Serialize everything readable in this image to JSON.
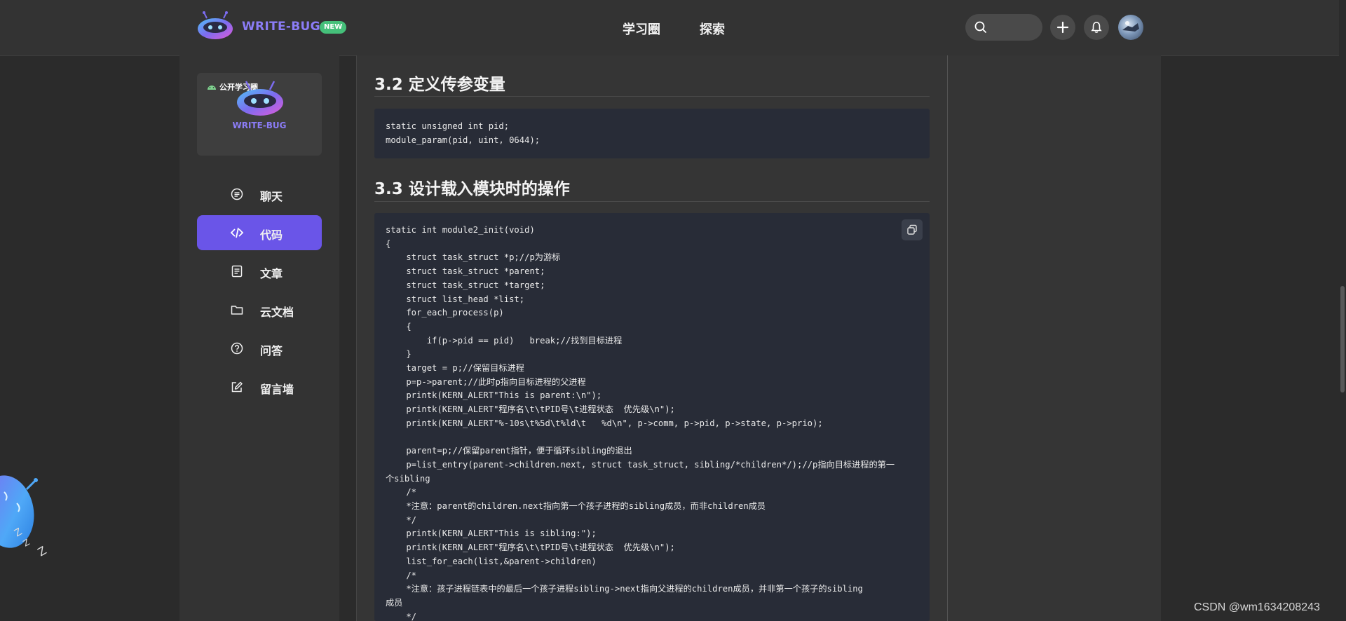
{
  "header": {
    "brand": "WRITE-BUG",
    "badge": "NEW",
    "nav": [
      "学习圈",
      "探索"
    ]
  },
  "group_card": {
    "tag": "公开学习圈",
    "brand": "WRITE-BUG"
  },
  "sidebar": {
    "items": [
      {
        "label": "聊天",
        "icon": "chat-icon"
      },
      {
        "label": "代码",
        "icon": "code-icon"
      },
      {
        "label": "文章",
        "icon": "article-icon"
      },
      {
        "label": "云文档",
        "icon": "folder-icon"
      },
      {
        "label": "问答",
        "icon": "question-icon"
      },
      {
        "label": "留言墙",
        "icon": "edit-icon"
      }
    ],
    "active_index": 1
  },
  "content": {
    "section_32": "3.2 定义传参变量",
    "code_32": "static unsigned int pid;\nmodule_param(pid, uint, 0644);",
    "section_33": "3.3 设计载入模块时的操作",
    "code_33": "static int module2_init(void)\n{\n    struct task_struct *p;//p为游标\n    struct task_struct *parent;\n    struct task_struct *target;\n    struct list_head *list;\n    for_each_process(p)\n    {\n        if(p->pid == pid)   break;//找到目标进程\n    }\n    target = p;//保留目标进程\n    p=p->parent;//此时p指向目标进程的父进程\n    printk(KERN_ALERT\"This is parent:\\n\");\n    printk(KERN_ALERT\"程序名\\t\\tPID号\\t进程状态  优先级\\n\");\n    printk(KERN_ALERT\"%-10s\\t%5d\\t%ld\\t   %d\\n\", p->comm, p->pid, p->state, p->prio);\n\n    parent=p;//保留parent指针，便于循环sibling的退出\n    p=list_entry(parent->children.next, struct task_struct, sibling/*children*/);//p指向目标进程的第一\n个sibling\n    /*\n    *注意：parent的children.next指向第一个孩子进程的sibling成员，而非children成员\n    */\n    printk(KERN_ALERT\"This is sibling:\");\n    printk(KERN_ALERT\"程序名\\t\\tPID号\\t进程状态  优先级\\n\");\n    list_for_each(list,&parent->children)\n    /*\n    *注意：孩子进程链表中的最后一个孩子进程sibling->next指向父进程的children成员，并非第一个孩子的sibling\n成员\n    */"
  },
  "watermark": "CSDN @wm1634208243",
  "colors": {
    "accent": "#6a55e8",
    "brand": "#8b7cf6",
    "badge": "#45c07a"
  }
}
